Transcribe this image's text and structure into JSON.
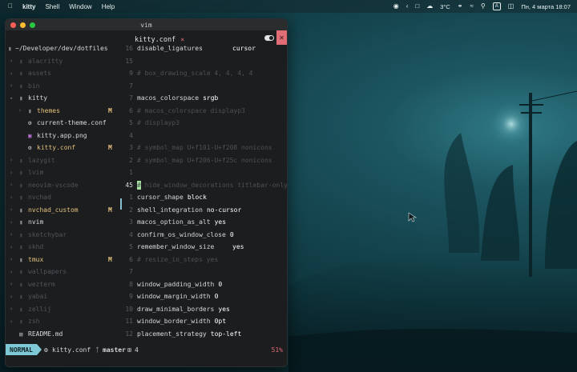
{
  "menubar": {
    "apple_icon": "apple-icon",
    "app_name": "kitty",
    "menus": [
      "Shell",
      "Window",
      "Help"
    ],
    "weather": "3°C",
    "input_source": "A",
    "clock": "Пн, 4 марта  18:07"
  },
  "window": {
    "title": "vim"
  },
  "tabline": {
    "active_tab": "kitty.conf",
    "close_label": "×"
  },
  "tree": {
    "root": "~/Developer/dev/dotfiles",
    "items": [
      {
        "label": "alacritty",
        "type": "folder",
        "depth": 0,
        "expanded": false,
        "dim": true,
        "git": ""
      },
      {
        "label": "assets",
        "type": "folder",
        "depth": 0,
        "expanded": false,
        "dim": true,
        "git": ""
      },
      {
        "label": "bin",
        "type": "folder",
        "depth": 0,
        "expanded": false,
        "dim": true,
        "git": ""
      },
      {
        "label": "kitty",
        "type": "folder",
        "depth": 0,
        "expanded": true,
        "dim": false,
        "git": ""
      },
      {
        "label": "themes",
        "type": "folder",
        "depth": 1,
        "expanded": false,
        "dim": false,
        "git": "M"
      },
      {
        "label": "current-theme.conf",
        "type": "gear",
        "depth": 1,
        "dim": false,
        "git": ""
      },
      {
        "label": "kitty.app.png",
        "type": "image",
        "depth": 1,
        "dim": false,
        "git": ""
      },
      {
        "label": "kitty.conf",
        "type": "gear",
        "depth": 1,
        "dim": false,
        "git": "M",
        "active": true
      },
      {
        "label": "lazygit",
        "type": "folder",
        "depth": 0,
        "expanded": false,
        "dim": true,
        "git": ""
      },
      {
        "label": "lvim",
        "type": "folder",
        "depth": 0,
        "expanded": false,
        "dim": true,
        "git": ""
      },
      {
        "label": "neovim-vscode",
        "type": "folder",
        "depth": 0,
        "expanded": false,
        "dim": true,
        "git": ""
      },
      {
        "label": "nvchad",
        "type": "folder",
        "depth": 0,
        "expanded": false,
        "dim": true,
        "git": ""
      },
      {
        "label": "nvchad_custom",
        "type": "folder",
        "depth": 0,
        "expanded": false,
        "dim": false,
        "git": "M"
      },
      {
        "label": "nvim",
        "type": "folder",
        "depth": 0,
        "expanded": false,
        "dim": false,
        "git": ""
      },
      {
        "label": "sketchybar",
        "type": "folder",
        "depth": 0,
        "expanded": false,
        "dim": true,
        "git": ""
      },
      {
        "label": "skhd",
        "type": "folder",
        "depth": 0,
        "expanded": false,
        "dim": true,
        "git": ""
      },
      {
        "label": "tmux",
        "type": "folder",
        "depth": 0,
        "expanded": false,
        "dim": false,
        "git": "M"
      },
      {
        "label": "wallpapers",
        "type": "folder",
        "depth": 0,
        "expanded": false,
        "dim": true,
        "git": ""
      },
      {
        "label": "wezterm",
        "type": "folder",
        "depth": 0,
        "expanded": false,
        "dim": true,
        "git": ""
      },
      {
        "label": "yabai",
        "type": "folder",
        "depth": 0,
        "expanded": false,
        "dim": true,
        "git": ""
      },
      {
        "label": "zellij",
        "type": "folder",
        "depth": 0,
        "expanded": false,
        "dim": true,
        "git": ""
      },
      {
        "label": "zsh",
        "type": "folder",
        "depth": 0,
        "expanded": false,
        "dim": true,
        "git": ""
      },
      {
        "label": "README.md",
        "type": "markdown",
        "depth": 0,
        "dim": false,
        "git": ""
      }
    ]
  },
  "editor": {
    "lines": [
      {
        "num": "16",
        "key": "disable_ligatures",
        "value": "cursor",
        "comment": false,
        "value_left": 140
      },
      {
        "num": "15",
        "key": "",
        "value": "",
        "comment": false
      },
      {
        "num": "9",
        "key": "# box_drawing_scale 4, 4, 4, 4",
        "value": "",
        "comment": true
      },
      {
        "num": "7",
        "key": "",
        "value": "",
        "comment": false
      },
      {
        "num": "7",
        "key": "macos_colorspace",
        "value": "srgb",
        "comment": false
      },
      {
        "num": "6",
        "key": "# macos_colorspace displayp3",
        "value": "",
        "comment": true
      },
      {
        "num": "5",
        "key": "# displayp3",
        "value": "",
        "comment": true
      },
      {
        "num": "4",
        "key": "",
        "value": "",
        "comment": false
      },
      {
        "num": "3",
        "key": "# symbol_map U+f101-U+f208 nonicons",
        "value": "",
        "comment": true
      },
      {
        "num": "2",
        "key": "# symbol_map U+f206-U+f25c nonicons",
        "value": "",
        "comment": true
      },
      {
        "num": "1",
        "key": "",
        "value": "",
        "comment": false
      },
      {
        "num": "45",
        "key": "# hide_window_decorations titlebar-only  Not",
        "value": "",
        "comment": true,
        "current": true
      },
      {
        "num": "1",
        "key": "cursor_shape",
        "value": "block",
        "comment": false
      },
      {
        "num": "2",
        "key": "shell_integration",
        "value": "no-cursor",
        "comment": false
      },
      {
        "num": "3",
        "key": "macos_option_as_alt",
        "value": "yes",
        "comment": false
      },
      {
        "num": "4",
        "key": "confirm_os_window_close",
        "value": "0",
        "comment": false
      },
      {
        "num": "5",
        "key": "remember_window_size",
        "value": "yes",
        "comment": false,
        "value_left": 140
      },
      {
        "num": "6",
        "key": "# resize_in_steps yes",
        "value": "",
        "comment": true
      },
      {
        "num": "7",
        "key": "",
        "value": "",
        "comment": false
      },
      {
        "num": "8",
        "key": "window_padding_width",
        "value": "0",
        "comment": false
      },
      {
        "num": "9",
        "key": "window_margin_width",
        "value": "0",
        "comment": false
      },
      {
        "num": "10",
        "key": "draw_minimal_borders",
        "value": "yes",
        "comment": false
      },
      {
        "num": "11",
        "key": "window_border_width",
        "value": "0pt",
        "comment": false
      },
      {
        "num": "12",
        "key": "placement_strategy",
        "value": "top-left",
        "comment": false
      }
    ]
  },
  "statusline": {
    "mode": "NORMAL",
    "file": "kitty.conf",
    "branch": "master",
    "changes": "4",
    "percent": "51%"
  },
  "colors": {
    "accent": "#7ec7d6",
    "git_modified": "#e5c07b",
    "close_red": "#e06c75",
    "folder": "#8a8f94",
    "comment": "#4c5257"
  }
}
